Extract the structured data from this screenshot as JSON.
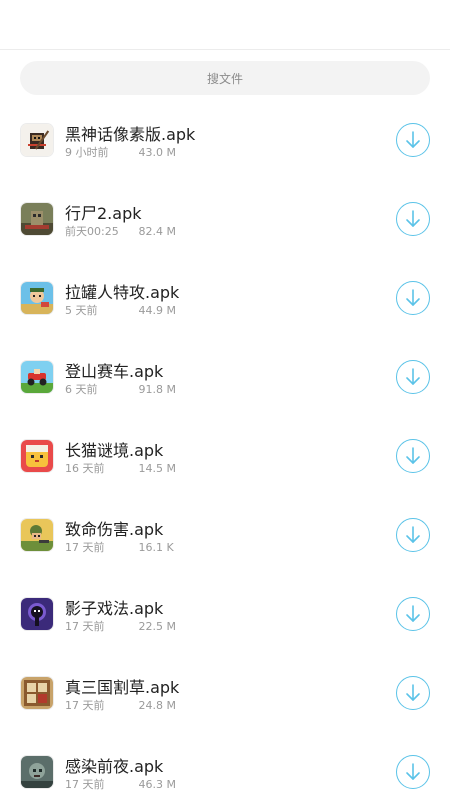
{
  "search": {
    "placeholder": "搜文件"
  },
  "files": [
    {
      "name": "黑神话像素版.apk",
      "time": "9 小时前",
      "size": "43.0 M",
      "icon": "black-myth-pixel-icon"
    },
    {
      "name": "行尸2.apk",
      "time": "前天00:25",
      "size": "82.4 M",
      "icon": "walking-dead-2-icon"
    },
    {
      "name": "拉罐人特攻.apk",
      "time": "5 天前",
      "size": "44.9 M",
      "icon": "can-man-assault-icon"
    },
    {
      "name": "登山赛车.apk",
      "time": "6 天前",
      "size": "91.8 M",
      "icon": "hill-climb-racing-icon"
    },
    {
      "name": "长猫谜境.apk",
      "time": "16 天前",
      "size": "14.5 M",
      "icon": "long-cat-maze-icon"
    },
    {
      "name": "致命伤害.apk",
      "time": "17 天前",
      "size": "16.1 K",
      "icon": "fatal-damage-icon"
    },
    {
      "name": "影子戏法.apk",
      "time": "17 天前",
      "size": "22.5 M",
      "icon": "shadow-trick-icon"
    },
    {
      "name": "真三国割草.apk",
      "time": "17 天前",
      "size": "24.8 M",
      "icon": "three-kingdoms-mowing-icon"
    },
    {
      "name": "感染前夜.apk",
      "time": "17 天前",
      "size": "46.3 M",
      "icon": "infection-eve-icon"
    }
  ],
  "colors": {
    "accent": "#5bc3e8",
    "text": "#222222",
    "meta": "#9a9a9a",
    "search_bg": "#f3f3f3"
  }
}
